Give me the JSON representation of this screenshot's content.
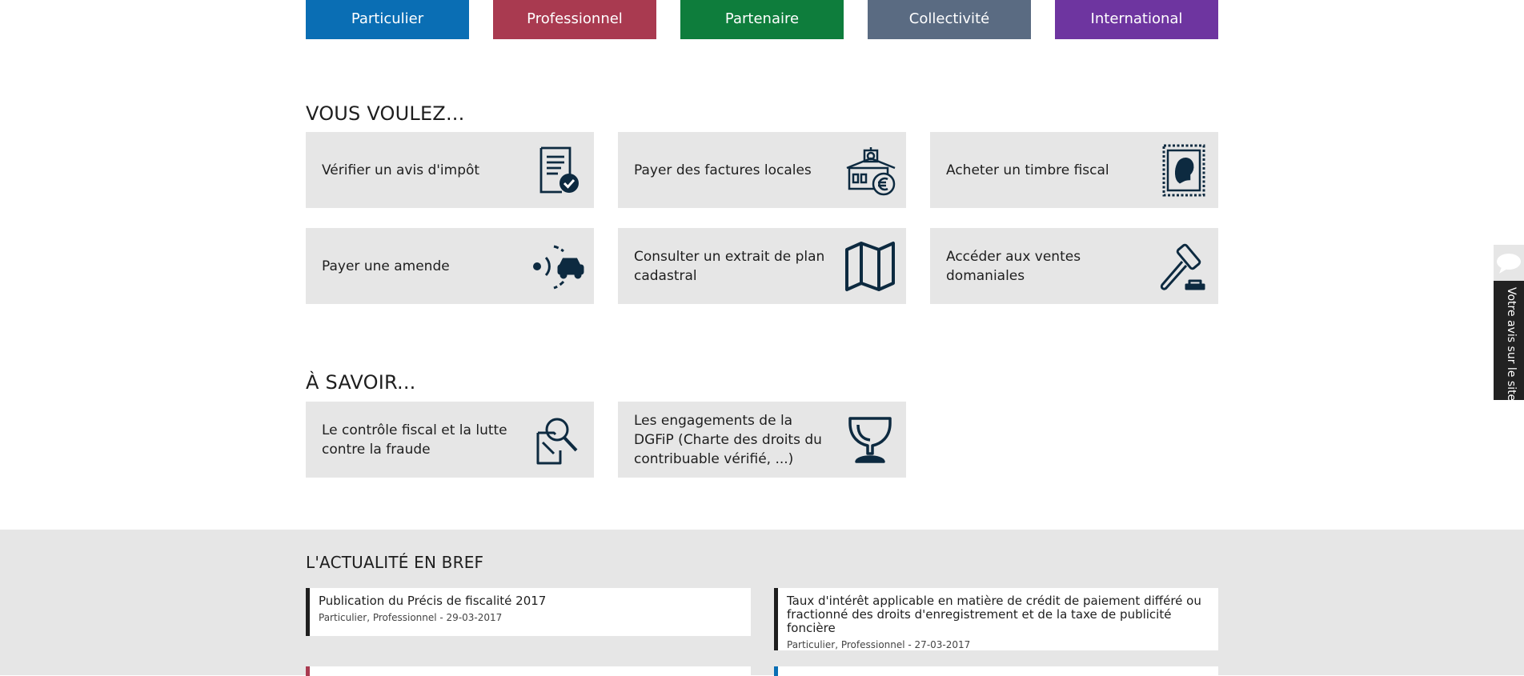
{
  "audience": [
    {
      "label": "Particulier",
      "color": "#0a6eb4"
    },
    {
      "label": "Professionnel",
      "color": "#a93a50"
    },
    {
      "label": "Partenaire",
      "color": "#0e7d3c"
    },
    {
      "label": "Collectivité",
      "color": "#5a6b82"
    },
    {
      "label": "International",
      "color": "#6e35a0"
    }
  ],
  "vous_voulez": {
    "title": "VOUS VOULEZ...",
    "tiles": [
      {
        "label": "Vérifier un avis d'impôt",
        "icon": "document-check-icon"
      },
      {
        "label": "Payer des factures locales",
        "icon": "town-hall-euro-icon"
      },
      {
        "label": "Acheter un timbre fiscal",
        "icon": "stamp-icon"
      },
      {
        "label": "Payer une amende",
        "icon": "speed-camera-car-icon"
      },
      {
        "label": "Consulter un extrait de plan cadastral",
        "icon": "map-icon"
      },
      {
        "label": "Accéder aux ventes domaniales",
        "icon": "auction-gavel-icon"
      }
    ]
  },
  "a_savoir": {
    "title": "À SAVOIR...",
    "tiles": [
      {
        "label": "Le contrôle fiscal et la lutte contre la fraude",
        "icon": "magnifier-document-icon"
      },
      {
        "label": "Les engagements de la DGFiP (Charte des droits du contribuable vérifié, ...)",
        "icon": "trophy-icon"
      }
    ]
  },
  "news": {
    "title": "L'ACTUALITÉ EN BREF",
    "items": [
      {
        "title": "Publication du Précis de fiscalité 2017",
        "meta": "Particulier, Professionnel - 29-03-2017"
      },
      {
        "title": "Taux d'intérêt applicable en matière de crédit de paiement différé ou fractionné des droits d'enregistrement et de la taxe de publicité foncière",
        "meta": "Particulier, Professionnel - 27-03-2017"
      }
    ]
  },
  "feedback": {
    "label": "Votre avis sur le site"
  },
  "colors": {
    "icon": "#0d2a40",
    "tile_bg": "#e6e6e6",
    "news_stub_left": "#a93a50",
    "news_stub_right": "#0a6eb4"
  }
}
